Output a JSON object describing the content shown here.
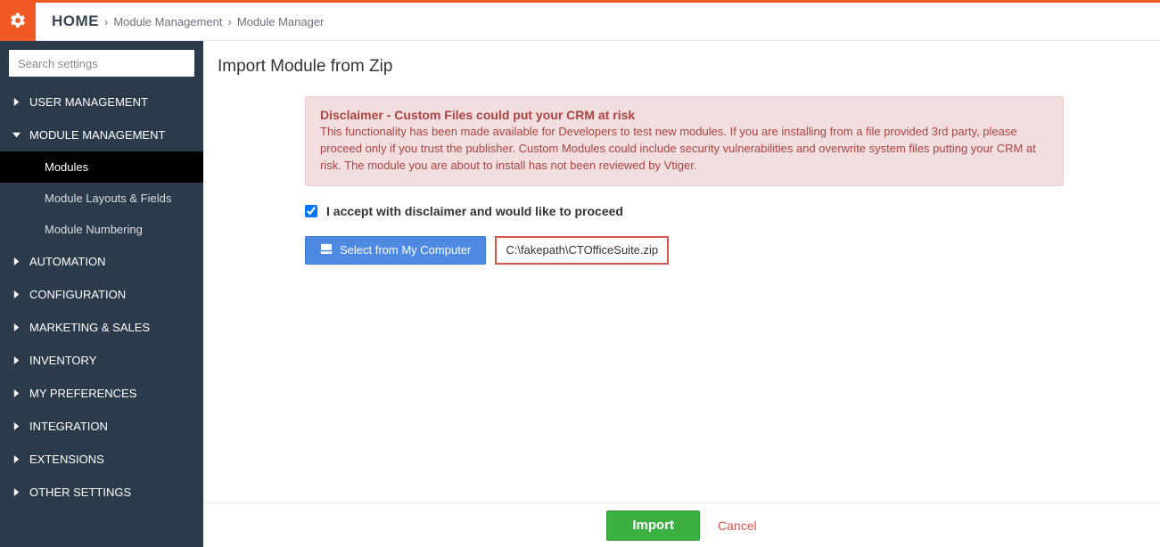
{
  "header": {
    "home": "HOME",
    "crumbs": [
      "Module Management",
      "Module Manager"
    ]
  },
  "sidebar": {
    "search_placeholder": "Search settings",
    "sections": [
      {
        "label": "USER MANAGEMENT",
        "expanded": false
      },
      {
        "label": "MODULE MANAGEMENT",
        "expanded": true,
        "items": [
          "Modules",
          "Module Layouts & Fields",
          "Module Numbering"
        ],
        "active_index": 0
      },
      {
        "label": "AUTOMATION",
        "expanded": false
      },
      {
        "label": "CONFIGURATION",
        "expanded": false
      },
      {
        "label": "MARKETING & SALES",
        "expanded": false
      },
      {
        "label": "INVENTORY",
        "expanded": false
      },
      {
        "label": "MY PREFERENCES",
        "expanded": false
      },
      {
        "label": "INTEGRATION",
        "expanded": false
      },
      {
        "label": "EXTENSIONS",
        "expanded": false
      },
      {
        "label": "OTHER SETTINGS",
        "expanded": false
      }
    ]
  },
  "main": {
    "title": "Import Module from Zip",
    "disclaimer": {
      "title": "Disclaimer - Custom Files could put your CRM at risk",
      "body": "This functionality has been made available for Developers to test new modules. If you are installing from a file provided 3rd party, please proceed only if you trust the publisher. Custom Modules could include security vulnerabilities and overwrite system files putting your CRM at risk. The module you are about to install has not been reviewed by Vtiger."
    },
    "accept_label": "I accept with disclaimer and would like to proceed",
    "accept_checked": true,
    "select_button": "Select from My Computer",
    "file_path": "C:\\fakepath\\CTOfficeSuite.zip"
  },
  "footer": {
    "import_label": "Import",
    "cancel_label": "Cancel"
  }
}
